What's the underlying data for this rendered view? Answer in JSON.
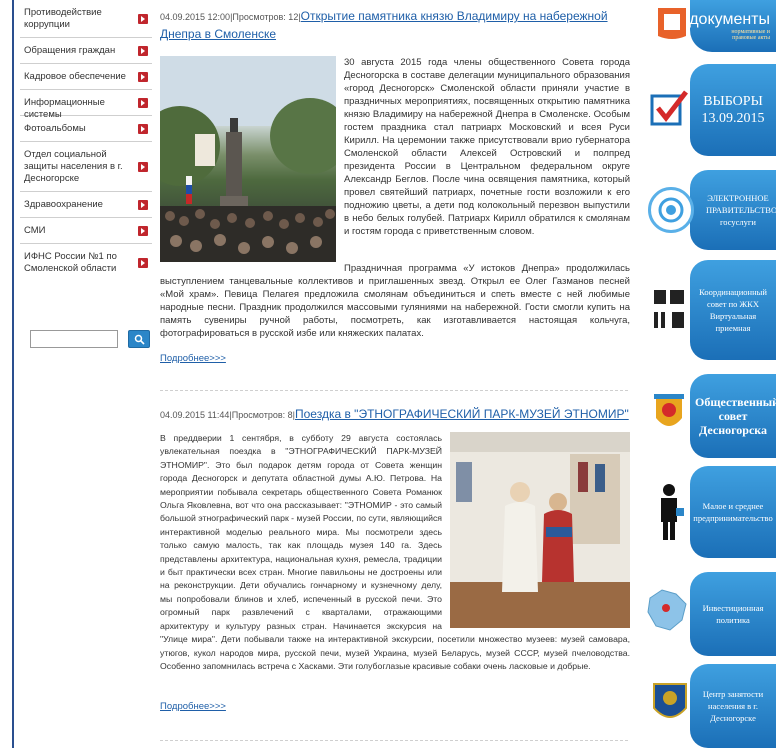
{
  "sidebar": {
    "items": [
      {
        "label": "Противодействие коррупции"
      },
      {
        "label": "Обращения граждан"
      },
      {
        "label": "Кадровое обеспечение"
      },
      {
        "label": "Информационные системы"
      },
      {
        "label": "Фотоальбомы"
      },
      {
        "label": "Отдел социальной защиты населения в г. Десногорске"
      },
      {
        "label": "Здравоохранение"
      },
      {
        "label": "СМИ"
      },
      {
        "label": "ИФНС России №1 по Смоленской области"
      }
    ],
    "search": {
      "value": "",
      "placeholder": ""
    }
  },
  "news": [
    {
      "date": "04.09.2015 12:00",
      "views": "Просмотров: 12",
      "title": "Открытие памятника князю Владимиру на набережной Днепра в Смоленске",
      "paragraph1": "30 августа 2015 года члены общественного Совета города Десногорска в составе делегации муниципального образования «город Десногорск» Смоленской области приняли участие в праздничных мероприятиях, посвященных открытию памятника князю Владимиру на набережной Днепра в Смоленске. Особым гостем праздника стал патриарх Московский и всея Руси Кирилл. На церемонии также присутствовали врио губернатора Смоленской области Алексей Островский и полпред президента России в Центральном федеральном округе Александр Беглов. После чина освящения памятника, который провел святейший патриарх, почетные гости возложили к его подножию цветы, а дети под колокольный перезвон выпустили в небо белых голубей. Патриарх Кирилл обратился к смолянам и гостям города с приветственным словом.",
      "paragraph2": "Праздничная программа «У истоков Днепра» продолжилась выступлением танцевальные коллективов и приглашенных звезд. Открыл ее Олег Газманов песней «Мой храм». Певица Пелагея предложила смолянам объединиться и спеть вместе с ней любимые народные песни. Праздник продолжился массовыми гуляниями на набережной. Гости смогли купить на память сувениры ручной работы, посмотреть, как изготавливается настоящая кольчуга, фотографироваться в русской избе или княжеских палатах.",
      "more": "Подробнее>>>"
    },
    {
      "date": "04.09.2015 11:44",
      "views": "Просмотров: 8",
      "title": "Поездка в \"ЭТНОГРАФИЧЕСКИЙ ПАРК-МУЗЕЙ ЭТНОМИР\"",
      "paragraph1": "В преддверии 1 сентября, в субботу 29 августа состоялась увлекательная поездка в \"ЭТНОГРАФИЧЕСКИЙ ПАРК-МУЗЕЙ ЭТНОМИР\". Это был подарок детям города от Совета женщин города Десногорск и депутата областной думы А.Ю. Петрова. На мероприятии побывала секретарь общественного Совета Романюк Ольга Яковлевна, вот что она рассказывает: \"ЭТНОМИР - это самый большой этнографический парк - музей России, по сути, являющийся интерактивной моделью реального мира. Мы посмотрели здесь только самую малость, так как площадь музея 140 га. Здесь представлены архитектура, национальная кухня, ремесла, традиции и быт практически всех стран. Многие павильоны не достроены или на реконструкции. Дети обучались гончарному и кузнечному делу, мы попробовали блинов и хлеб, испеченный в русской печи. Это огромный парк развлечений с кварталами, отражающими архитектуру и культуру разных стран. Начинается экскурсия на \"Улице мира\". Дети побывали также на интерактивной экскурсии, посетили множество музеев: музей самовара, утюгов, кукол народов мира, русской печи, музей Украина, музей Беларусь, музей СССР, музей пчеловодства. Особенно запомнилась встреча с Хасками. Эти голубоглазые красивые собаки очень ласковые и добрые.",
      "more": "Подробнее>>>"
    }
  ],
  "banners": [
    {
      "label": "документы",
      "sub": "нормативные и правовые акты",
      "icon": "documents-icon"
    },
    {
      "label": "ВЫБОРЫ 13.09.2015",
      "icon": "checkmark-icon"
    },
    {
      "label": "ЭЛЕКТРОННОЕ ПРАВИТЕЛЬСТВО госуслуги",
      "icon": "e-government-icon"
    },
    {
      "label": "Координационный совет по ЖКХ Виртуальная приемная",
      "icon": "housing-tools-icon"
    },
    {
      "label": "Общественный совет Десногорска",
      "icon": "coat-of-arms-icon"
    },
    {
      "label": "Малое и среднее предпринимательство",
      "icon": "business-person-icon"
    },
    {
      "label": "Инвестиционная политика",
      "icon": "region-map-icon"
    },
    {
      "label": "Центр занятости населения в г. Десногорске",
      "icon": "emblem-icon"
    }
  ],
  "colors": {
    "accent": "#1f5fa8",
    "banner": "#2b86c8",
    "menu_arrow": "#c0262d"
  }
}
